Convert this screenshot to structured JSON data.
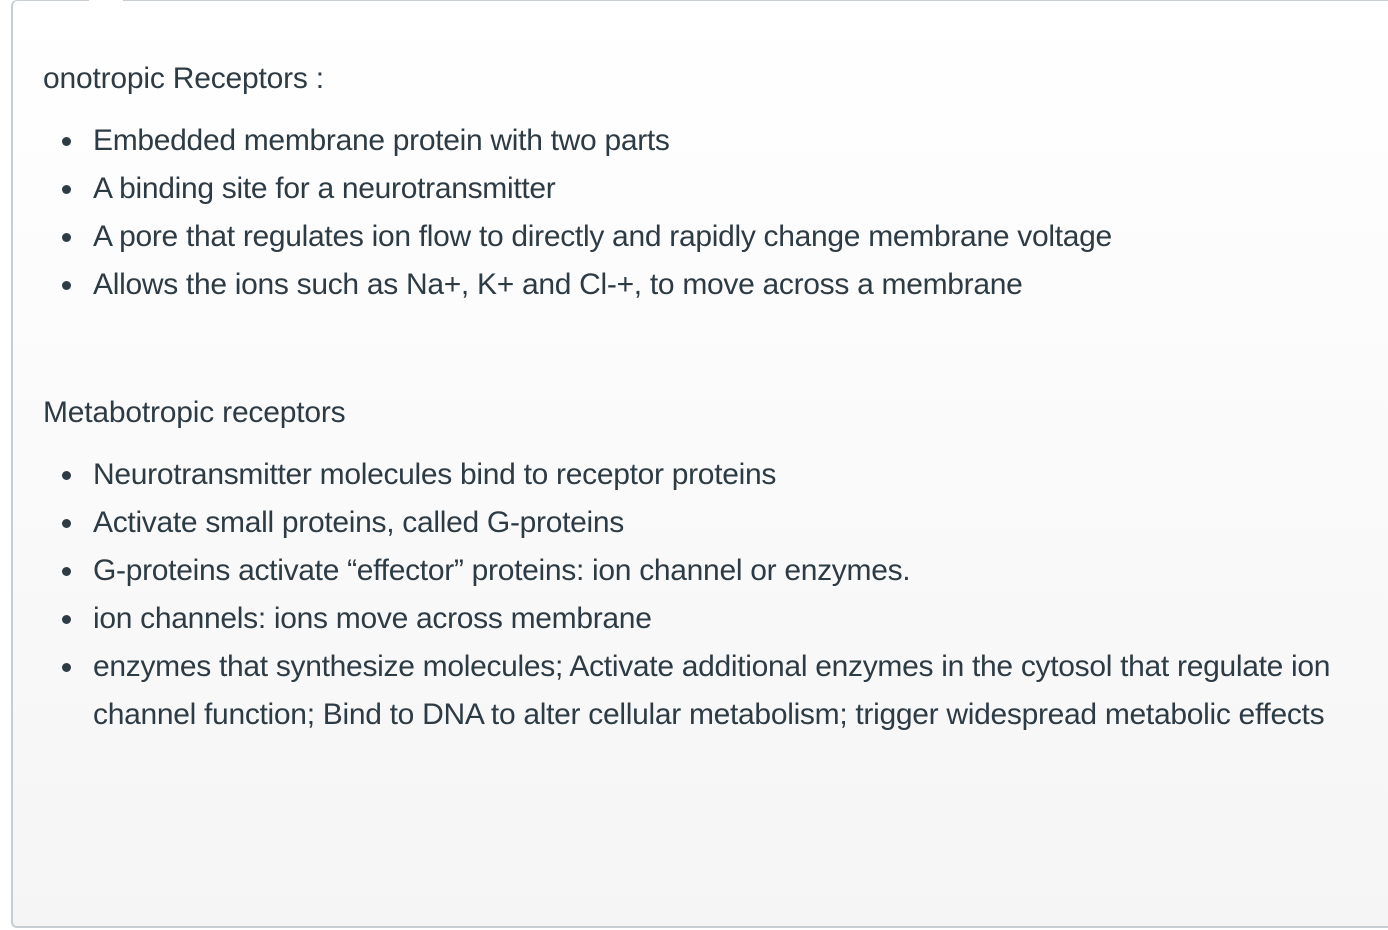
{
  "sections": [
    {
      "heading": "onotropic Receptors :",
      "items": [
        "Embedded membrane protein with two parts",
        "A binding site for a neurotransmitter",
        "A pore that regulates ion flow to directly and rapidly change membrane voltage",
        "Allows the ions such as Na+, K+ and Cl-+, to move across a membrane"
      ]
    },
    {
      "heading": "Metabotropic receptors",
      "items": [
        "Neurotransmitter molecules bind to receptor proteins",
        "Activate small proteins, called G-proteins",
        "G-proteins activate “effector” proteins: ion channel or enzymes.",
        "ion channels: ions move across membrane",
        "enzymes that synthesize molecules; Activate additional enzymes in the cytosol that regulate ion channel function; Bind to DNA to alter cellular metabolism; trigger widespread metabolic effects"
      ]
    }
  ],
  "icons": {
    "bullet": "bullet-icon"
  }
}
